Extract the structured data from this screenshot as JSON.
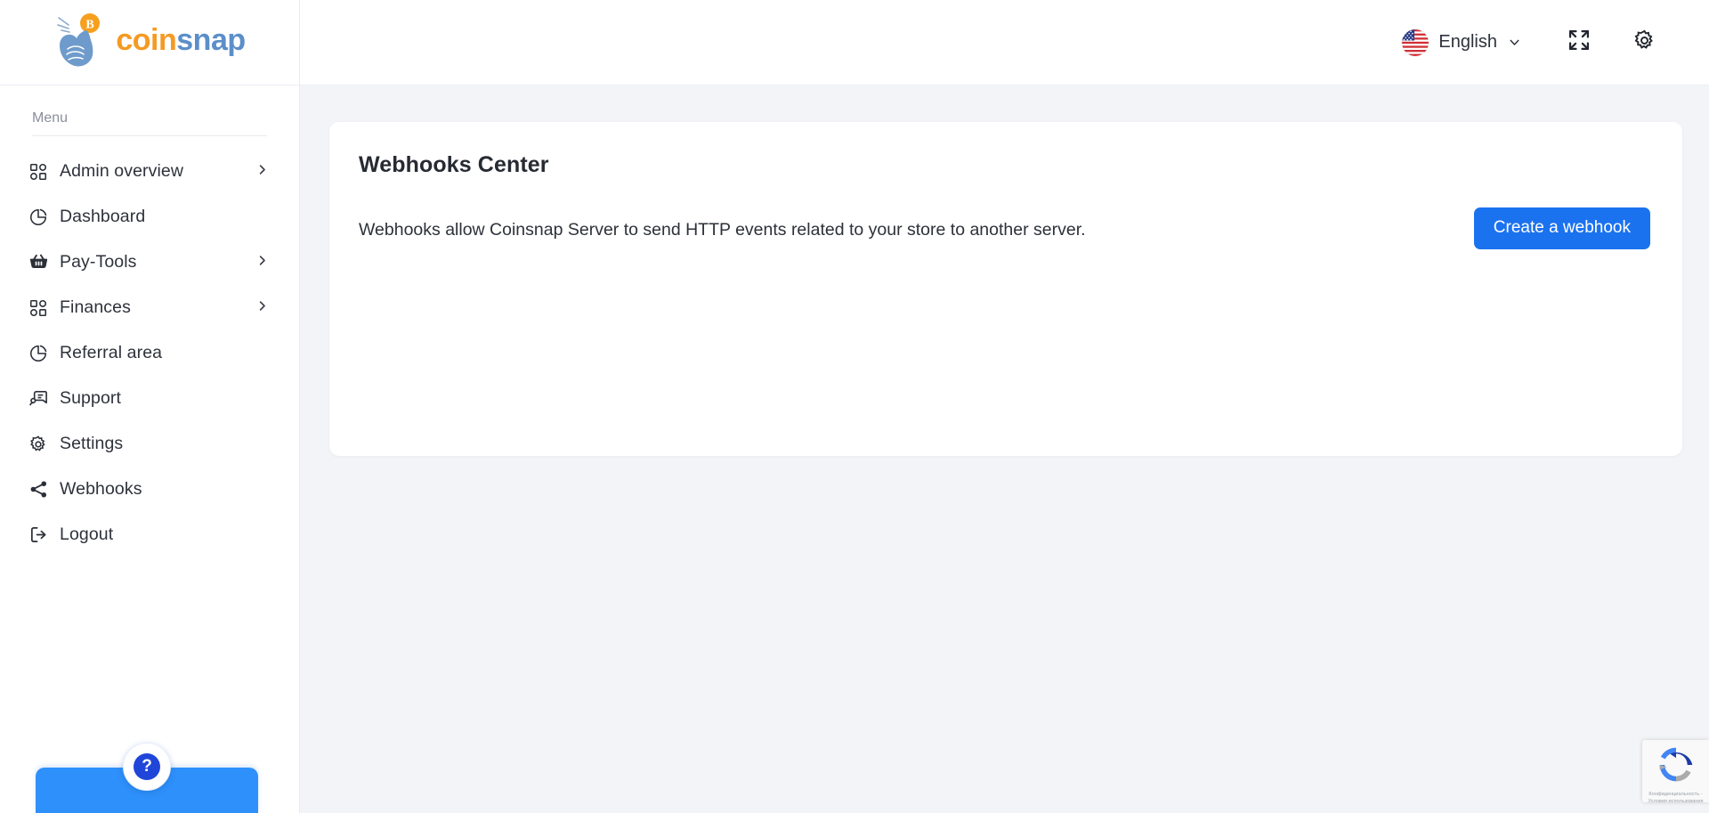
{
  "brand": {
    "name_part1": "coin",
    "name_part2": "snap",
    "color_orange": "#f59a23",
    "color_blue": "#5b8fc9"
  },
  "sidebar": {
    "section_label": "Menu",
    "items": [
      {
        "label": "Admin overview",
        "icon": "grid-icon",
        "expandable": true
      },
      {
        "label": "Dashboard",
        "icon": "pie-chart-icon",
        "expandable": false
      },
      {
        "label": "Pay-Tools",
        "icon": "basket-icon",
        "expandable": true
      },
      {
        "label": "Finances",
        "icon": "grid-icon",
        "expandable": true
      },
      {
        "label": "Referral area",
        "icon": "pie-chart-icon",
        "expandable": false
      },
      {
        "label": "Support",
        "icon": "chat-bubble-icon",
        "expandable": false
      },
      {
        "label": "Settings",
        "icon": "gear-icon",
        "expandable": false
      },
      {
        "label": "Webhooks",
        "icon": "share-icon",
        "expandable": false
      },
      {
        "label": "Logout",
        "icon": "logout-icon",
        "expandable": false
      }
    ],
    "help_widget": {
      "icon": "question-mark-icon",
      "label": "?"
    }
  },
  "topbar": {
    "language": "English",
    "language_flag": "us-flag-icon",
    "chevron": "chevron-down-icon",
    "fullscreen_icon": "fullscreen-expand-icon",
    "settings_icon": "gear-icon"
  },
  "main": {
    "card": {
      "title": "Webhooks Center",
      "description": "Webhooks allow Coinsnap Server to send HTTP events related to your store to another server.",
      "create_button": "Create a webhook",
      "accent_color": "#1b72ef"
    }
  },
  "recaptcha": {
    "line1": "Конфиденциальность -",
    "line2": "Условия использования"
  }
}
